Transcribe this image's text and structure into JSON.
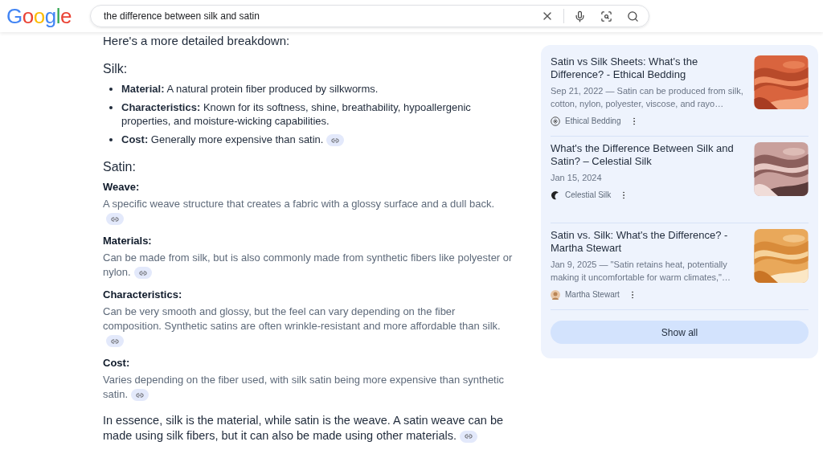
{
  "search": {
    "logo": "Google",
    "query": "the difference between silk and satin"
  },
  "answer": {
    "intro": "Here's a more detailed breakdown:",
    "sections": [
      {
        "heading": "Silk:",
        "kind": "bullets",
        "items": [
          {
            "term": "Material:",
            "text": "A natural protein fiber produced by silkworms.",
            "link": false
          },
          {
            "term": "Characteristics:",
            "text": "Known for its softness, shine, breathability, hypoallergenic properties, and moisture-wicking capabilities.",
            "link": false
          },
          {
            "term": "Cost:",
            "text": "Generally more expensive than satin.",
            "link": true
          }
        ]
      },
      {
        "heading": "Satin:",
        "kind": "definitions",
        "items": [
          {
            "term": "Weave:",
            "text": "A specific weave structure that creates a fabric with a glossy surface and a dull back.",
            "link": true
          },
          {
            "term": "Materials:",
            "text": "Can be made from silk, but is also commonly made from synthetic fibers like polyester or nylon.",
            "link": true
          },
          {
            "term": "Characteristics:",
            "text": "Can be very smooth and glossy, but the feel can vary depending on the fiber composition. Synthetic satins are often wrinkle-resistant and more affordable than silk.",
            "link": true
          },
          {
            "term": "Cost:",
            "text": "Varies depending on the fiber used, with silk satin being more expensive than synthetic satin.",
            "link": true
          }
        ]
      }
    ],
    "conclusion": {
      "text": "In essence, silk is the material, while satin is the weave. A satin weave can be made using silk fibers, but it can also be made using other materials.",
      "link": true
    }
  },
  "sources": {
    "items": [
      {
        "title": "Satin vs Silk Sheets: What's the Difference? - Ethical Bedding",
        "snippet": "Sep 21, 2022 — Satin can be produced from silk, cotton, nylon, polyester, viscose, and rayo…",
        "site": "Ethical Bedding",
        "kind": "emblem"
      },
      {
        "title": "What's the Difference Between Silk and Satin? – Celestial Silk",
        "snippet": "Jan 15, 2024",
        "site": "Celestial Silk",
        "kind": "crescent"
      },
      {
        "title": "Satin vs. Silk: What's the Difference? - Martha Stewart",
        "snippet": "Jan 9, 2025 — \"Satin retains heat, potentially making it uncomfortable for warm climates,\"…",
        "site": "Martha Stewart",
        "kind": "avatar"
      }
    ],
    "button": "Show all"
  }
}
